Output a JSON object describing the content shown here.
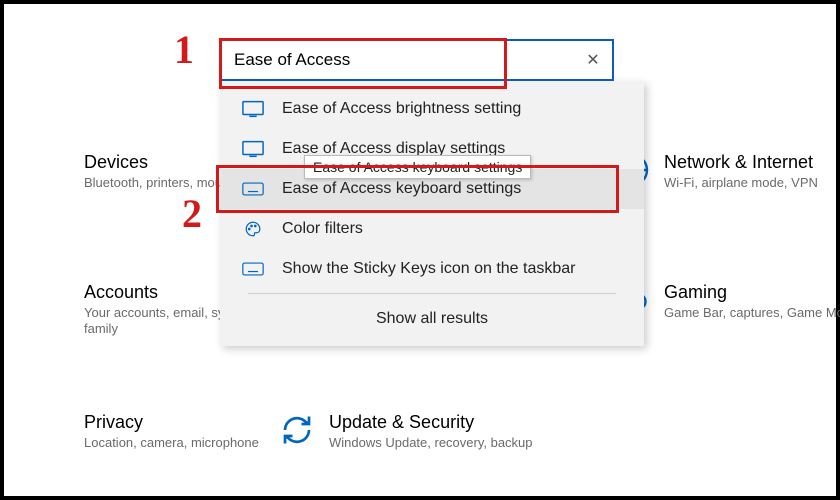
{
  "annotations": {
    "n1": "1",
    "n2": "2"
  },
  "search": {
    "value": "Ease of Access",
    "clear_glyph": "✕"
  },
  "results": [
    {
      "label": "Ease of Access brightness setting",
      "icon": "monitor"
    },
    {
      "label": "Ease of Access display settings",
      "icon": "monitor",
      "tooltip": "Ease of Access keyboard settings"
    },
    {
      "label": "Ease of Access keyboard settings",
      "icon": "keyboard",
      "highlighted": true
    },
    {
      "label": "Color filters",
      "icon": "palette"
    },
    {
      "label": "Show the Sticky Keys icon on the taskbar",
      "icon": "keyboard"
    }
  ],
  "show_all_label": "Show all results",
  "categories": {
    "devices": {
      "title": "Devices",
      "sub": "Bluetooth, printers, mouse"
    },
    "netint": {
      "title": "Network & Internet",
      "sub": "Wi-Fi, airplane mode, VPN"
    },
    "accounts": {
      "title": "Accounts",
      "sub": "Your accounts, email, sync, work, family"
    },
    "gaming": {
      "title": "Gaming",
      "sub": "Game Bar, captures, Game Mode"
    },
    "privacy": {
      "title": "Privacy",
      "sub": "Location, camera, microphone"
    },
    "update": {
      "title": "Update & Security",
      "sub": "Windows Update, recovery, backup"
    }
  }
}
